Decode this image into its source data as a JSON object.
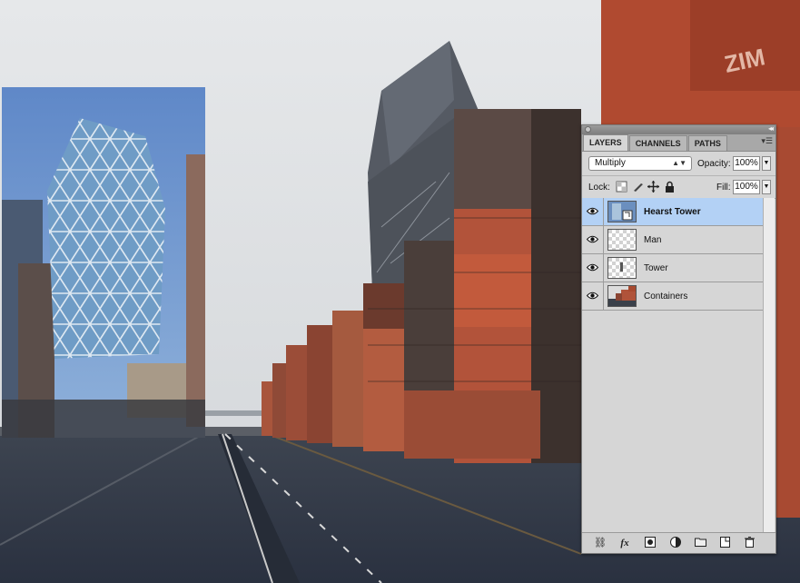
{
  "panel": {
    "tabs": [
      {
        "label": "LAYERS",
        "active": true
      },
      {
        "label": "CHANNELS",
        "active": false
      },
      {
        "label": "PATHS",
        "active": false
      }
    ],
    "blend_mode": "Multiply",
    "opacity_label": "Opacity:",
    "opacity_value": "100%",
    "lock_label": "Lock:",
    "fill_label": "Fill:",
    "fill_value": "100%",
    "layers": [
      {
        "name": "Hearst Tower",
        "selected": true,
        "visible": true,
        "thumb_icon": "smart-object-thumb"
      },
      {
        "name": "Man",
        "selected": false,
        "visible": true,
        "thumb_icon": "transparent-thumb"
      },
      {
        "name": "Tower",
        "selected": false,
        "visible": true,
        "thumb_icon": "transparent-thumb"
      },
      {
        "name": "Containers",
        "selected": false,
        "visible": true,
        "thumb_icon": "containers-thumb"
      }
    ],
    "footer_icons": [
      "link-icon",
      "fx-icon",
      "mask-icon",
      "adjustment-icon",
      "folder-icon",
      "new-layer-icon",
      "trash-icon"
    ]
  },
  "colors": {
    "selection": "#b3d1f5",
    "panel_bg": "#d6d6d6"
  }
}
